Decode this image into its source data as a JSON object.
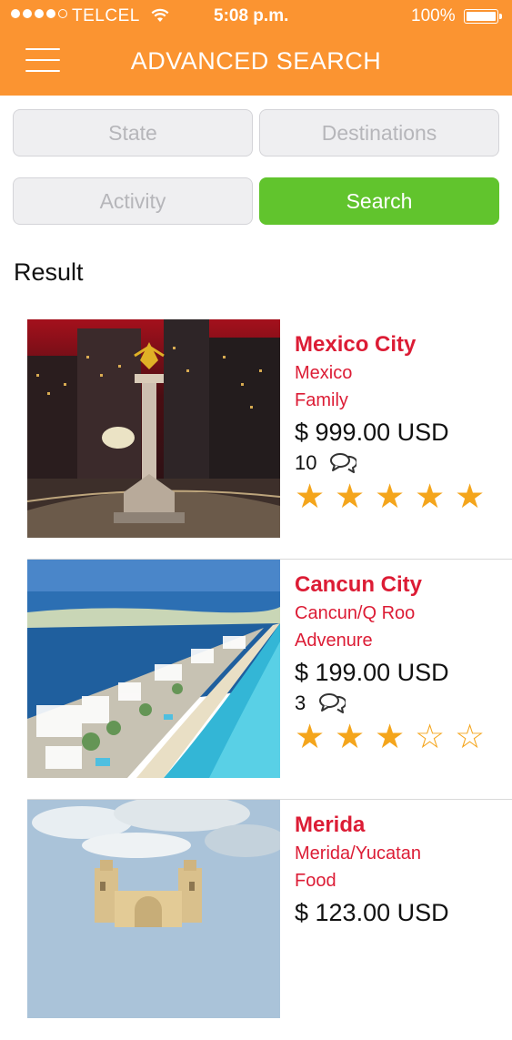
{
  "status_bar": {
    "carrier": "TELCEL",
    "time": "5:08 p.m.",
    "battery": "100%"
  },
  "header": {
    "title": "ADVANCED SEARCH",
    "menu_icon": "hamburger-menu-icon"
  },
  "filters": {
    "state_label": "State",
    "destinations_label": "Destinations",
    "activity_label": "Activity",
    "search_label": "Search"
  },
  "result_heading": "Result",
  "colors": {
    "header": "#fb9431",
    "search_button": "#61c42d",
    "title_red": "#dc1c35",
    "star": "#f4a51c"
  },
  "results": [
    {
      "name": "Mexico City",
      "location": "Mexico",
      "category": "Family",
      "price": "$ 999.00 USD",
      "reviews": "10",
      "rating": 5,
      "image": "angel-of-independence-photo"
    },
    {
      "name": "Cancun City",
      "location": "Cancun/Q Roo",
      "category": "Advenure",
      "price": "$ 199.00 USD",
      "reviews": "3",
      "rating": 3,
      "image": "cancun-hotel-zone-aerial-photo"
    },
    {
      "name": "Merida",
      "location": "Merida/Yucatan",
      "category": "Food",
      "price": "$ 123.00 USD",
      "image": "merida-cathedral-photo"
    }
  ]
}
